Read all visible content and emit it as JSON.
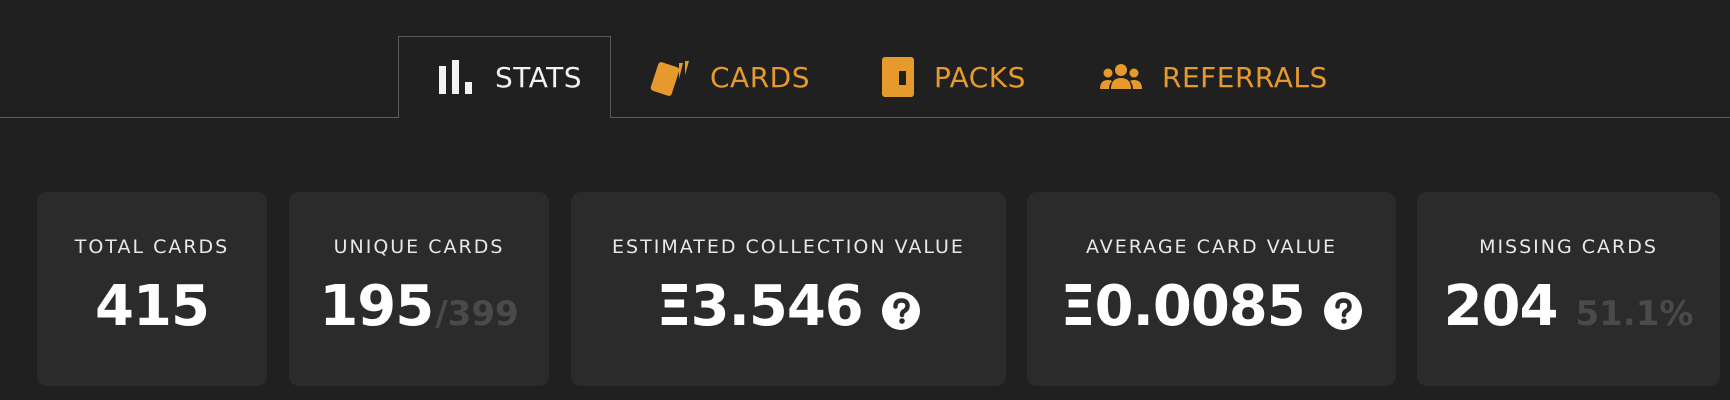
{
  "tabs": [
    {
      "label": "STATS",
      "icon": "bar-chart-icon",
      "active": true
    },
    {
      "label": "CARDS",
      "icon": "cards-icon",
      "active": false
    },
    {
      "label": "PACKS",
      "icon": "pack-icon",
      "active": false
    },
    {
      "label": "REFERRALS",
      "icon": "people-icon",
      "active": false
    }
  ],
  "colors": {
    "background": "#202020",
    "card": "#2b2b2b",
    "accent": "#e79a2c",
    "active_tab_text": "#f2f2f2",
    "muted": "#4a4a4a"
  },
  "stats": {
    "total_cards": {
      "label": "TOTAL CARDS",
      "value": "415"
    },
    "unique_cards": {
      "label": "UNIQUE CARDS",
      "value": "195",
      "sub": "/399"
    },
    "collection_value": {
      "label": "ESTIMATED COLLECTION VALUE",
      "value": "Ξ3.546",
      "help_icon": "question-circle-icon"
    },
    "average_value": {
      "label": "AVERAGE CARD VALUE",
      "value": "Ξ0.0085",
      "help_icon": "question-circle-icon"
    },
    "missing_cards": {
      "label": "MISSING CARDS",
      "value": "204",
      "sub": "51.1%"
    }
  }
}
